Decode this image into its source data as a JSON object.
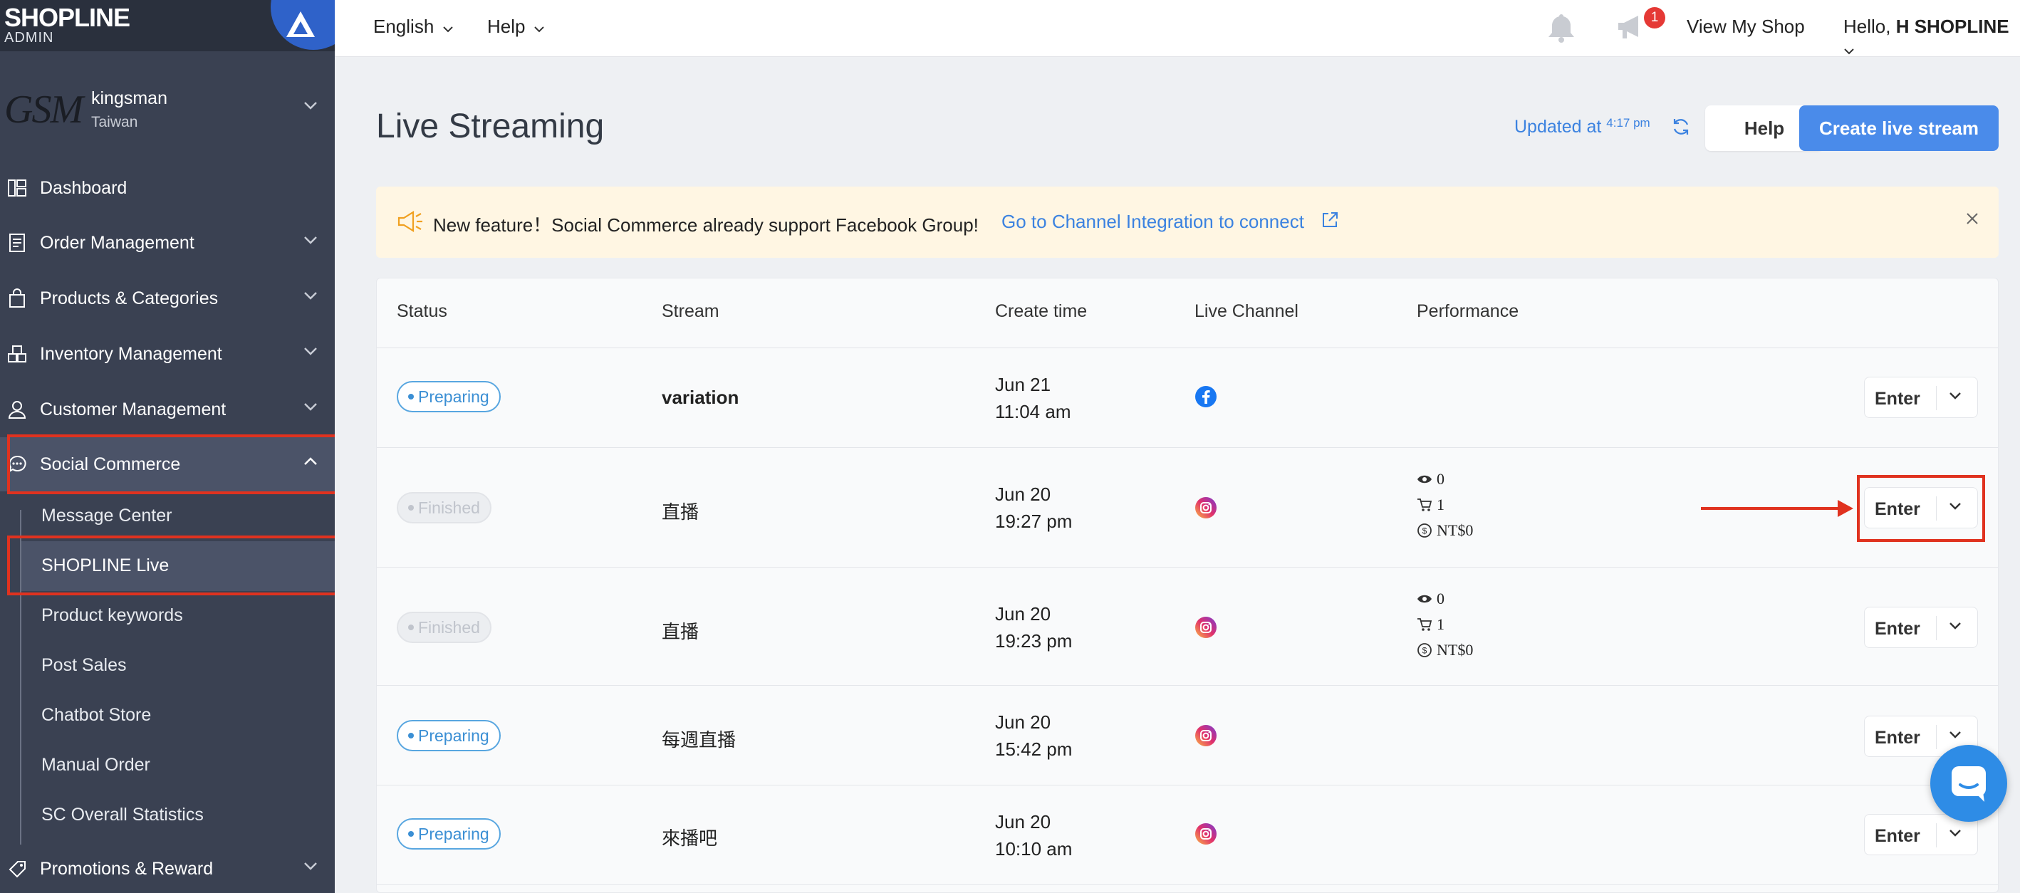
{
  "app": {
    "logo_text": "SHOPLINE",
    "logo_sub": "ADMIN"
  },
  "shop": {
    "logo_text": "GSM",
    "name": "kingsman",
    "region": "Taiwan"
  },
  "sidebar": {
    "items": [
      {
        "label": "Dashboard",
        "icon": "dashboard-icon"
      },
      {
        "label": "Order Management",
        "icon": "order-icon"
      },
      {
        "label": "Products & Categories",
        "icon": "shopping-bag-icon"
      },
      {
        "label": "Inventory Management",
        "icon": "inventory-icon"
      },
      {
        "label": "Customer Management",
        "icon": "user-icon"
      },
      {
        "label": "Social Commerce",
        "icon": "chat-bubble-icon"
      },
      {
        "label": "Promotions & Reward",
        "icon": "tag-icon"
      }
    ],
    "sub_items": [
      {
        "label": "Message Center"
      },
      {
        "label": "SHOPLINE Live"
      },
      {
        "label": "Product keywords"
      },
      {
        "label": "Post Sales"
      },
      {
        "label": "Chatbot Store"
      },
      {
        "label": "Manual Order"
      },
      {
        "label": "SC Overall Statistics"
      }
    ]
  },
  "topbar": {
    "language": "English",
    "help": "Help",
    "notification_count": "1",
    "view_shop": "View My Shop",
    "greeting": "Hello,",
    "user": "H SHOPLINE"
  },
  "page": {
    "title": "Live Streaming",
    "updated_label": "Updated at",
    "updated_time": "4:17 pm",
    "help_button": "Help",
    "create_button": "Create live stream"
  },
  "banner": {
    "message": "New feature！Social Commerce already support Facebook Group!",
    "link": "Go to Channel Integration to connect"
  },
  "table": {
    "headers": [
      "Status",
      "Stream",
      "Create time",
      "Live Channel",
      "Performance"
    ],
    "enter_label": "Enter",
    "rows": [
      {
        "status": "Preparing",
        "stream": "variation",
        "date": "Jun 21",
        "time": "11:04 am",
        "channel": "facebook"
      },
      {
        "status": "Finished",
        "stream": "直播",
        "date": "Jun 20",
        "time": "19:27 pm",
        "channel": "instagram",
        "views": "0",
        "orders": "1",
        "sales": "NT$0"
      },
      {
        "status": "Finished",
        "stream": "直播",
        "date": "Jun 20",
        "time": "19:23 pm",
        "channel": "instagram",
        "views": "0",
        "orders": "1",
        "sales": "NT$0"
      },
      {
        "status": "Preparing",
        "stream": "每週直播",
        "date": "Jun 20",
        "time": "15:42 pm",
        "channel": "instagram"
      },
      {
        "status": "Preparing",
        "stream": "來播吧",
        "date": "Jun 20",
        "time": "10:10 am",
        "channel": "instagram"
      }
    ]
  },
  "colors": {
    "sidebar_bg": "#3a4152",
    "accent": "#4a8bea",
    "highlight_red": "#e0321f",
    "banner_bg": "#fff6e3"
  }
}
